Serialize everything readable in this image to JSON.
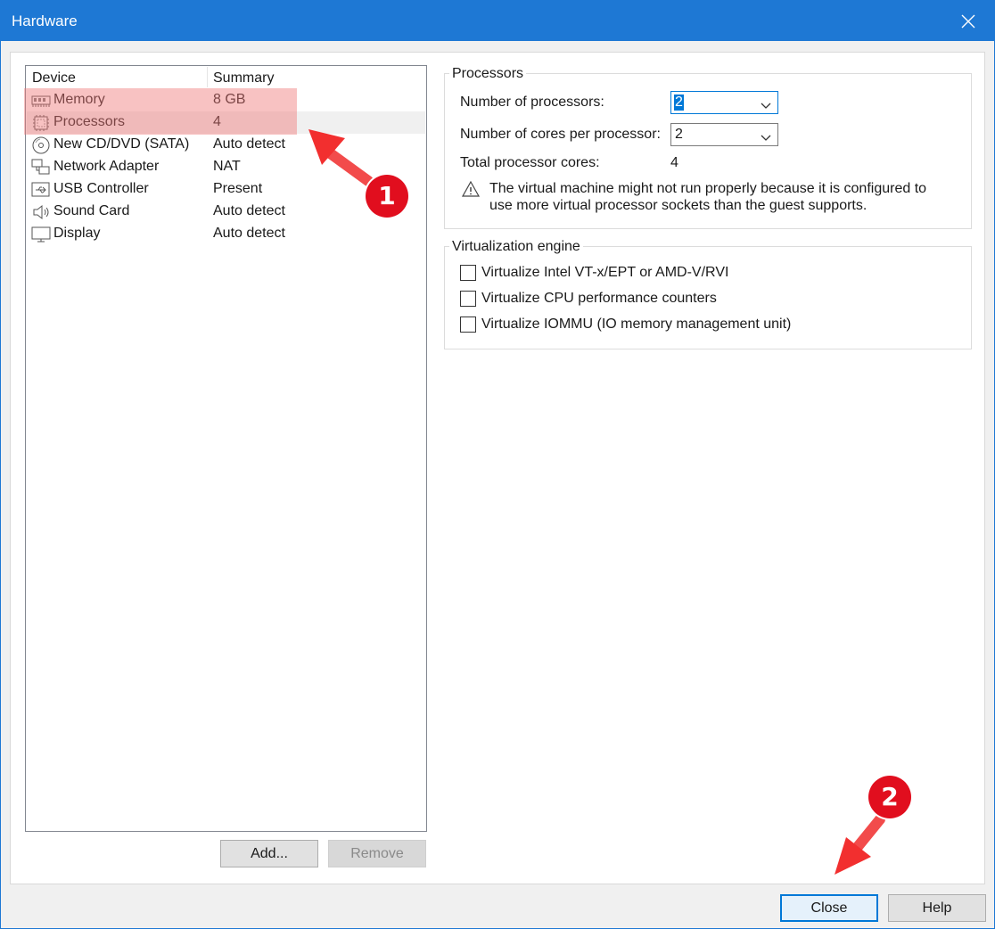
{
  "window": {
    "title": "Hardware"
  },
  "device_list": {
    "columns": [
      "Device",
      "Summary"
    ],
    "rows": [
      {
        "icon": "memory-icon",
        "name": "Memory",
        "summary": "8 GB"
      },
      {
        "icon": "processor-icon",
        "name": "Processors",
        "summary": "4"
      },
      {
        "icon": "cd-dvd-icon",
        "name": "New CD/DVD (SATA)",
        "summary": "Auto detect"
      },
      {
        "icon": "network-adapter-icon",
        "name": "Network Adapter",
        "summary": "NAT"
      },
      {
        "icon": "usb-icon",
        "name": "USB Controller",
        "summary": "Present"
      },
      {
        "icon": "speaker-icon",
        "name": "Sound Card",
        "summary": "Auto detect"
      },
      {
        "icon": "display-icon",
        "name": "Display",
        "summary": "Auto detect"
      }
    ],
    "selected": "Processors",
    "add_label": "Add...",
    "remove_label": "Remove"
  },
  "processors": {
    "group_label": "Processors",
    "num_processors_label": "Number of processors:",
    "num_processors_value": "2",
    "cores_label": "Number of cores per processor:",
    "cores_value": "2",
    "total_label": "Total processor cores:",
    "total_value": "4",
    "warning": "The virtual machine might not run properly because it is configured to use more virtual processor sockets than the guest supports."
  },
  "virtualization": {
    "group_label": "Virtualization engine",
    "options": [
      {
        "label": "Virtualize Intel VT-x/EPT or AMD-V/RVI",
        "checked": false
      },
      {
        "label": "Virtualize CPU performance counters",
        "checked": false
      },
      {
        "label": "Virtualize IOMMU (IO memory management unit)",
        "checked": false
      }
    ]
  },
  "footer": {
    "close_label": "Close",
    "help_label": "Help"
  },
  "annotations": {
    "badge1": "1",
    "badge2": "2"
  },
  "colors": {
    "accent": "#1e78d4",
    "badge": "#e10e1e",
    "highlight": "#f07878"
  }
}
